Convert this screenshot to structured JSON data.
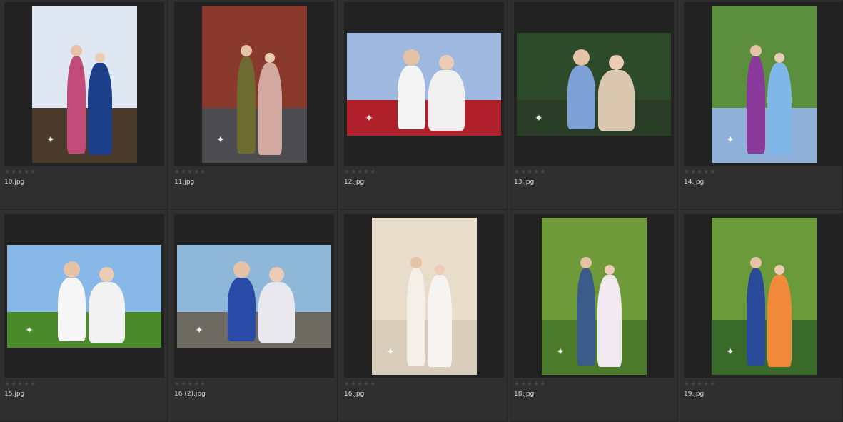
{
  "browser": {
    "items": [
      {
        "filename": "10.jpg",
        "rating": "★★★★★",
        "orientation": "portrait",
        "sky": "#dfe8f2",
        "ground": "#4a3a2c",
        "fig1": "#c24b7a",
        "fig2": "#1d3f8a"
      },
      {
        "filename": "11.jpg",
        "rating": "★★★★★",
        "orientation": "portrait",
        "sky": "#8a3a2c",
        "ground": "#4c4c50",
        "fig1": "#6d6b30",
        "fig2": "#d2a9a0"
      },
      {
        "filename": "12.jpg",
        "rating": "★★★★★",
        "orientation": "landscape",
        "sky": "#9fb8e0",
        "ground": "#b0202a",
        "fig1": "#f4f4f4",
        "fig2": "#f0f0f0"
      },
      {
        "filename": "13.jpg",
        "rating": "★★★★★",
        "orientation": "landscape",
        "sky": "#2d4a2a",
        "ground": "#2a3d26",
        "fig1": "#7ea2d8",
        "fig2": "#d9c7b0"
      },
      {
        "filename": "14.jpg",
        "rating": "★★★★★",
        "orientation": "portrait",
        "sky": "#5b8f3e",
        "ground": "#8fb0d8",
        "fig1": "#8a3a9a",
        "fig2": "#7fb8e8"
      },
      {
        "filename": "15.jpg",
        "rating": "★★★★★",
        "orientation": "landscape",
        "sky": "#87b8e8",
        "ground": "#4a8a2a",
        "fig1": "#f6f6f6",
        "fig2": "#f2f2f2"
      },
      {
        "filename": "16 (2).jpg",
        "rating": "★★★★★",
        "orientation": "landscape",
        "sky": "#8fb8d8",
        "ground": "#6d6a62",
        "fig1": "#2a4aa8",
        "fig2": "#e8e8ee"
      },
      {
        "filename": "16.jpg",
        "rating": "★★★★★",
        "orientation": "portrait",
        "sky": "#e8dccb",
        "ground": "#d8ccbb",
        "fig1": "#f4f0e8",
        "fig2": "#f6f4f0"
      },
      {
        "filename": "18.jpg",
        "rating": "★★★★★",
        "orientation": "portrait",
        "sky": "#6f9a3a",
        "ground": "#4a7a2a",
        "fig1": "#3a5a8a",
        "fig2": "#f2e8f0"
      },
      {
        "filename": "19.jpg",
        "rating": "★★★★★",
        "orientation": "portrait",
        "sky": "#6a9a3a",
        "ground": "#3a6a2a",
        "fig1": "#2a4a9a",
        "fig2": "#f08a3a"
      }
    ]
  }
}
